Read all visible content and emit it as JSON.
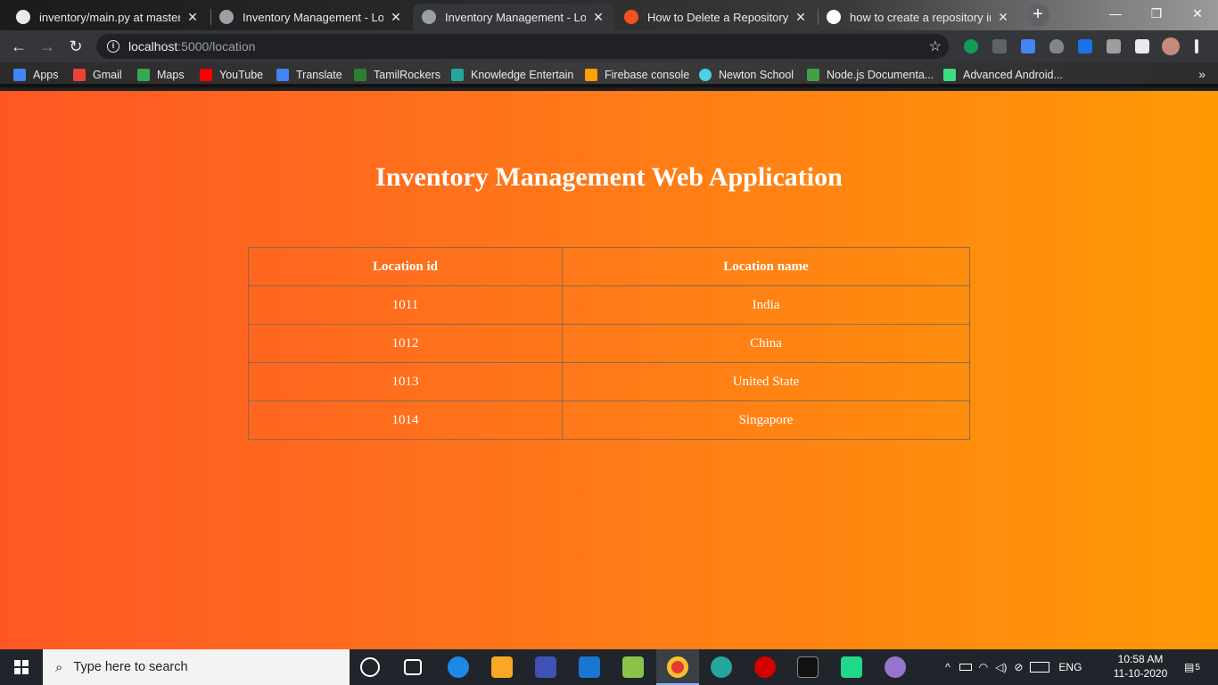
{
  "browser": {
    "tabs": [
      {
        "label": "inventory/main.py at master · N",
        "favicon": "github-icon",
        "active": false
      },
      {
        "label": "Inventory Management - Login",
        "favicon": "globe-icon",
        "active": false
      },
      {
        "label": "Inventory Management - Login",
        "favicon": "globe-icon",
        "active": true
      },
      {
        "label": "How to Delete a Repository in",
        "favicon": "gear-icon",
        "active": false
      },
      {
        "label": "how to create a repository in g",
        "favicon": "google-icon",
        "active": false
      }
    ],
    "close_glyph": "✕",
    "new_tab_glyph": "+",
    "window_controls": {
      "minimize": "—",
      "restore": "❐",
      "close": "✕"
    },
    "nav": {
      "back": "←",
      "forward": "→",
      "reload": "↻"
    },
    "url": {
      "host": "localhost",
      "path": ":5000/location"
    },
    "star": "☆",
    "bookmarks": [
      {
        "label": "Apps",
        "color": "#4285f4"
      },
      {
        "label": "Gmail",
        "color": "#ea4335"
      },
      {
        "label": "Maps",
        "color": "#34a853"
      },
      {
        "label": "YouTube",
        "color": "#ff0000"
      },
      {
        "label": "Translate",
        "color": "#4285f4"
      },
      {
        "label": "TamilRockers",
        "color": "#2e7d32"
      },
      {
        "label": "Knowledge Entertain",
        "color": "#26a69a"
      },
      {
        "label": "Firebase console",
        "color": "#ffa000"
      },
      {
        "label": "Newton School",
        "color": "#4dd0e1"
      },
      {
        "label": "Node.js Documenta...",
        "color": "#43a047"
      },
      {
        "label": "Advanced Android...",
        "color": "#3ddc84"
      }
    ],
    "bookmarks_more": "»"
  },
  "page": {
    "heading": "Inventory Management Web Application",
    "table": {
      "columns": [
        "Location id",
        "Location name"
      ],
      "rows": [
        [
          "1011",
          "India"
        ],
        [
          "1012",
          "China"
        ],
        [
          "1013",
          "United State"
        ],
        [
          "1014",
          "Singapore"
        ]
      ]
    }
  },
  "taskbar": {
    "search_placeholder": "Type here to search",
    "language": "ENG",
    "time": "10:58 AM",
    "date": "11-10-2020",
    "notifications": "5"
  },
  "colors": {
    "page_gradient_start": "#ff5724",
    "page_gradient_end": "#ff9a05",
    "heading_text": "#ffffff"
  }
}
